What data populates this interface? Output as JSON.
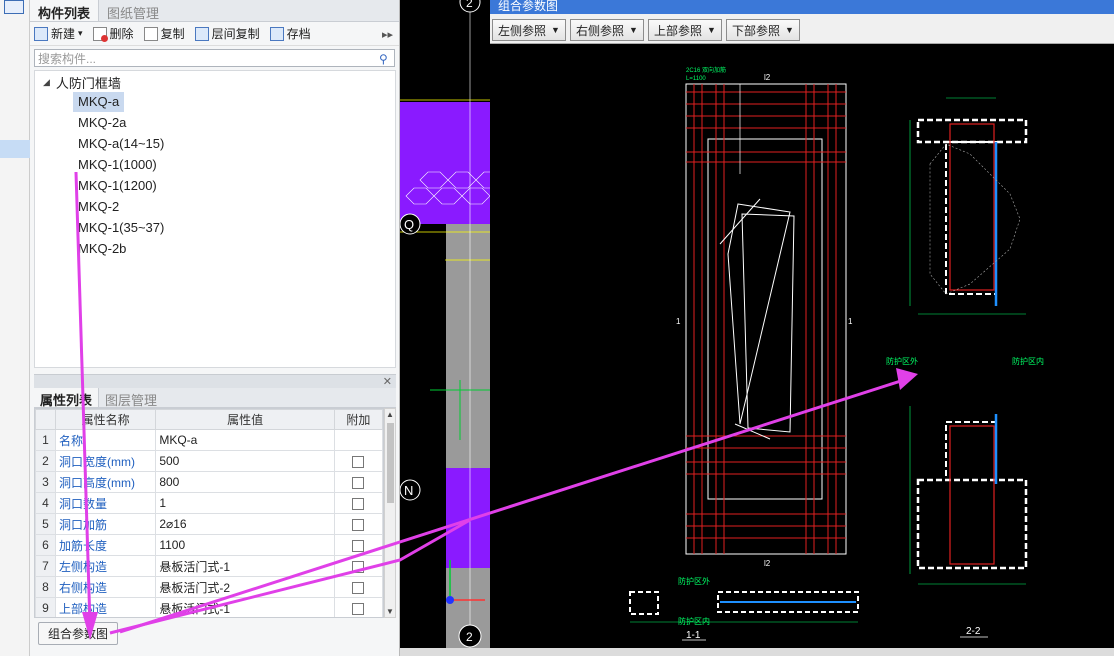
{
  "left_tabs": [
    "构件列表",
    "图纸管理"
  ],
  "toolbar": {
    "new": "新建",
    "delete": "删除",
    "copy": "复制",
    "floor_copy": "层间复制",
    "archive": "存档",
    "more": "▸▸"
  },
  "search": {
    "placeholder": "搜索构件..."
  },
  "tree": {
    "root": "人防门框墙",
    "items": [
      "MKQ-a",
      "MKQ-2a",
      "MKQ-a(14~15)",
      "MKQ-1(1000)",
      "MKQ-1(1200)",
      "MKQ-2",
      "MKQ-1(35~37)",
      "MKQ-2b"
    ],
    "selected_index": 0
  },
  "prop_tabs": [
    "属性列表",
    "图层管理"
  ],
  "prop_table": {
    "headers": [
      "属性名称",
      "属性值",
      "附加"
    ],
    "rows": [
      {
        "num": "1",
        "name": "名称",
        "value": "MKQ-a",
        "has_check": false
      },
      {
        "num": "2",
        "name": "洞口宽度(mm)",
        "value": "500",
        "has_check": true
      },
      {
        "num": "3",
        "name": "洞口高度(mm)",
        "value": "800",
        "has_check": true
      },
      {
        "num": "4",
        "name": "洞口数量",
        "value": "1",
        "has_check": true
      },
      {
        "num": "5",
        "name": "洞口加筋",
        "value": "2⌀16",
        "has_check": true
      },
      {
        "num": "6",
        "name": "加筋长度",
        "value": "1100",
        "has_check": true
      },
      {
        "num": "7",
        "name": "左侧构造",
        "value": "悬板活门式-1",
        "has_check": true
      },
      {
        "num": "8",
        "name": "右侧构造",
        "value": "悬板活门式-2",
        "has_check": true
      },
      {
        "num": "9",
        "name": "上部构造",
        "value": "悬板活门式-1",
        "has_check": true
      }
    ]
  },
  "combo_button": "组合参数图",
  "dialog": {
    "title": "组合参数图",
    "dropdowns": [
      "左侧参照",
      "右侧参照",
      "上部参照",
      "下部参照"
    ]
  },
  "drawing_labels": {
    "bar_note": "2C16 双向加筋",
    "bar_len": "L=1100",
    "grid_2": "2",
    "grid_q": "Q",
    "grid_n": "N",
    "outside": "防护区外",
    "inside": "防护区内",
    "section_11": "1-1",
    "section_22": "2-2",
    "l2": "l2",
    "one": "1"
  },
  "colors": {
    "accent_blue": "#3b78d8",
    "annotation_magenta": "#e040e8",
    "cad_red": "#e02020",
    "cad_purple": "#8a1aff"
  }
}
